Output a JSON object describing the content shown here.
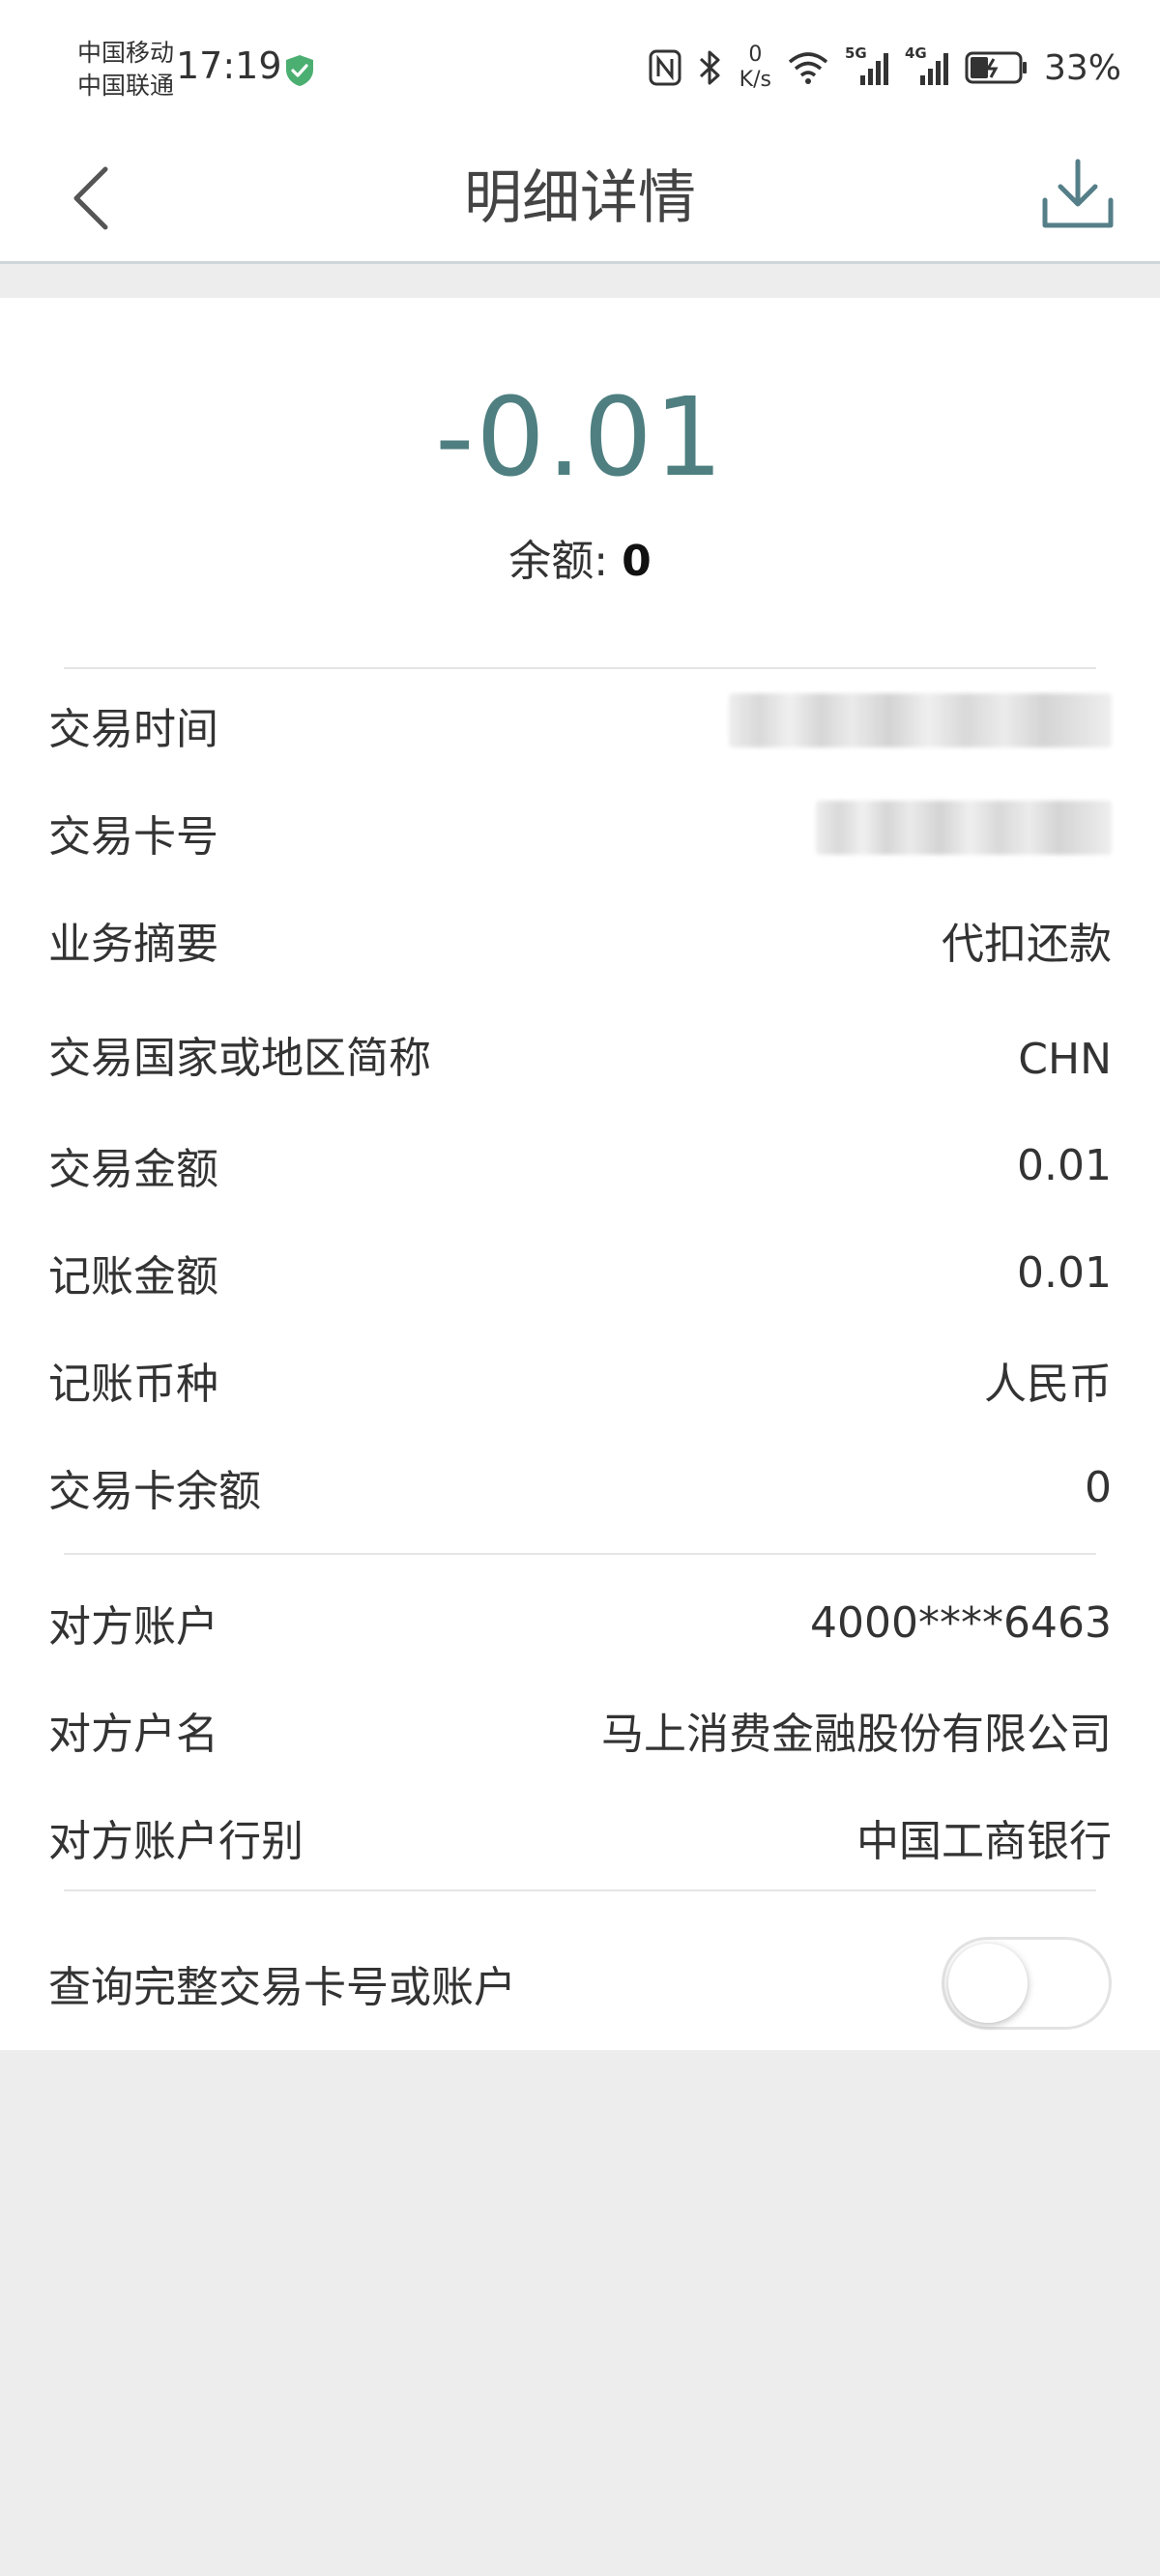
{
  "status_bar": {
    "carrier_1": "中国移动",
    "carrier_2": "中国联通",
    "time": "17:19",
    "net_speed_value": "0",
    "net_speed_unit": "K/s",
    "signal_1_label": "5G",
    "signal_2_label": "4G",
    "battery_percent": "33%",
    "shield_color": "#4caf72"
  },
  "nav": {
    "title": "明细详情"
  },
  "summary": {
    "amount": "-0.01",
    "balance_label": "余额: ",
    "balance_value": "0",
    "amount_color": "#4f7f80"
  },
  "details": [
    {
      "label": "交易时间",
      "value": ""
    },
    {
      "label": "交易卡号",
      "value": ""
    },
    {
      "label": "业务摘要",
      "value": "代扣还款"
    },
    {
      "label": "交易国家或地区简称",
      "value": "CHN"
    },
    {
      "label": "交易金额",
      "value": "0.01"
    },
    {
      "label": "记账金额",
      "value": "0.01"
    },
    {
      "label": "记账币种",
      "value": "人民币"
    },
    {
      "label": "交易卡余额",
      "value": "0"
    }
  ],
  "counterparty": [
    {
      "label": "对方账户",
      "value": "4000****6463"
    },
    {
      "label": "对方户名",
      "value": "马上消费金融股份有限公司"
    },
    {
      "label": "对方账户行别",
      "value": "中国工商银行"
    }
  ],
  "toggle_row": {
    "label": "查询完整交易卡号或账户",
    "on": false
  }
}
